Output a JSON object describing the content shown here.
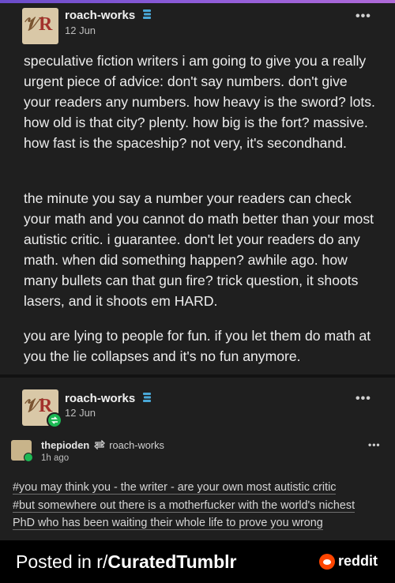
{
  "post1": {
    "username": "roach-works",
    "date": "12 Jun",
    "menu_label": "•••",
    "paragraphs": [
      "speculative fiction writers i am going to give you a really urgent piece of advice: don't say numbers. don't give your readers any numbers. how heavy is the sword? lots. how old is that city? plenty. how big is the fort? massive. how fast is the spaceship? not very, it's secondhand.",
      "the minute you say a number your readers can check your math and you cannot do math better than your most autistic critic. i guarantee. don't let your readers do any math. when did something happen? awhile ago. how many bullets can that gun fire? trick question, it shoots lasers, and it shoots em HARD.",
      "you are lying to people for fun. if you let them do math at you the lie collapses and it's no fun anymore."
    ]
  },
  "post2": {
    "username": "roach-works",
    "date": "12 Jun",
    "menu_label": "•••"
  },
  "reblog": {
    "username": "thepioden",
    "reblogged_from": "roach-works",
    "time": "1h ago",
    "menu_label": "•••",
    "tags": [
      "#you may think you - the writer - are your own most autistic critic",
      "#but somewhere out there is a motherfucker with the world's nichest",
      "PhD who has been waiting their whole life to prove you wrong"
    ]
  },
  "footer": {
    "prefix": "Posted in r/",
    "subreddit": "CuratedTumblr",
    "brand": "reddit"
  },
  "colors": {
    "background": "#1f1f1f",
    "verified_badge": "#4aa8d8",
    "reblog_green": "#1db954",
    "reddit_orange": "#ff4500"
  }
}
